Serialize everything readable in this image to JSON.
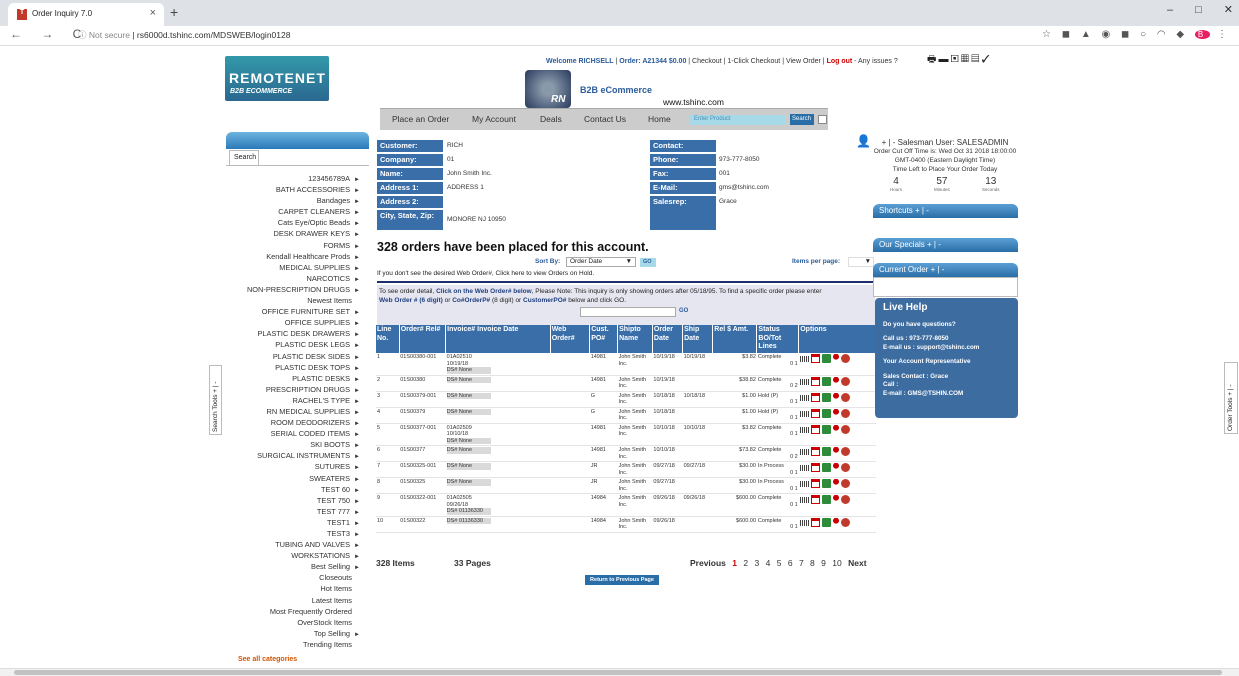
{
  "browser": {
    "tab_title": "Order Inquiry 7.0",
    "tab_close": "×",
    "new_tab": "+",
    "nav": "← → C",
    "url_secure": "ⓘ Not secure",
    "url": "rs6000d.tshinc.com/MDSWEB/login0128",
    "window_controls": [
      "–",
      "□",
      "✕"
    ]
  },
  "header": {
    "logo_line1": "REMOTENET",
    "logo_line2": "B2B ECOMMERCE",
    "rn_logo": "RN",
    "b2b_title": "B2B eCommerce",
    "site": "www.tshinc.com",
    "welcome": "Welcome RICHSELL",
    "order": "Order: A21344 $0.00",
    "links": "| Checkout | 1-Click Checkout | View Order |",
    "logout": "Log out",
    "issues": "- Any issues ?"
  },
  "topnav": {
    "items": [
      "Place an Order",
      "My Account",
      "Deals",
      "Contact Us",
      "Home"
    ],
    "search_placeholder": "Enter Product",
    "search_button": "Search"
  },
  "sidebar": {
    "tab": "Search",
    "categories": [
      {
        "label": "123456789A",
        "arrow": "►"
      },
      {
        "label": "BATH ACCESSORIES",
        "arrow": "►"
      },
      {
        "label": "Bandages",
        "arrow": "►"
      },
      {
        "label": "CARPET CLEANERS",
        "arrow": "►"
      },
      {
        "label": "Cats Eye/Optic Beads",
        "arrow": "►"
      },
      {
        "label": "DESK DRAWER KEYS",
        "arrow": "►"
      },
      {
        "label": "FORMS",
        "arrow": "►"
      },
      {
        "label": "Kendall Healthcare Prods",
        "arrow": "►"
      },
      {
        "label": "MEDICAL SUPPLIES",
        "arrow": "►"
      },
      {
        "label": "NARCOTICS",
        "arrow": "►"
      },
      {
        "label": "NON-PRESCRIPTION DRUGS",
        "arrow": "►"
      },
      {
        "label": "Newest Items",
        "arrow": ""
      },
      {
        "label": "OFFICE FURNITURE SET",
        "arrow": "►"
      },
      {
        "label": "OFFICE SUPPLIES",
        "arrow": "►"
      },
      {
        "label": "PLASTIC DESK DRAWERS",
        "arrow": "►"
      },
      {
        "label": "PLASTIC DESK LEGS",
        "arrow": "►"
      },
      {
        "label": "PLASTIC DESK SIDES",
        "arrow": "►"
      },
      {
        "label": "PLASTIC DESK TOPS",
        "arrow": "►"
      },
      {
        "label": "PLASTIC DESKS",
        "arrow": "►"
      },
      {
        "label": "PRESCRIPTION DRUGS",
        "arrow": "►"
      },
      {
        "label": "RACHEL'S TYPE",
        "arrow": "►"
      },
      {
        "label": "RN MEDICAL SUPPLIES",
        "arrow": "►"
      },
      {
        "label": "ROOM DEODORIZERS",
        "arrow": "►"
      },
      {
        "label": "SERIAL CODED ITEMS",
        "arrow": "►"
      },
      {
        "label": "SKI BOOTS",
        "arrow": "►"
      },
      {
        "label": "SURGICAL INSTRUMENTS",
        "arrow": "►"
      },
      {
        "label": "SUTURES",
        "arrow": "►"
      },
      {
        "label": "SWEATERS",
        "arrow": "►"
      },
      {
        "label": "TEST 60",
        "arrow": "►"
      },
      {
        "label": "TEST 750",
        "arrow": "►"
      },
      {
        "label": "TEST 777",
        "arrow": "►"
      },
      {
        "label": "TEST1",
        "arrow": "►"
      },
      {
        "label": "TEST3",
        "arrow": "►"
      },
      {
        "label": "TUBING AND VALVES",
        "arrow": "►"
      },
      {
        "label": "WORKSTATIONS",
        "arrow": "►"
      },
      {
        "label": "Best Selling",
        "arrow": "►"
      },
      {
        "label": "Closeouts",
        "arrow": ""
      },
      {
        "label": "Hot Items",
        "arrow": ""
      },
      {
        "label": "Latest Items",
        "arrow": ""
      },
      {
        "label": "Most Frequently Ordered",
        "arrow": ""
      },
      {
        "label": "OverStock Items",
        "arrow": ""
      },
      {
        "label": "Top Selling",
        "arrow": "►"
      },
      {
        "label": "Trending Items",
        "arrow": ""
      }
    ],
    "see_all": "See all categories",
    "search_tools": "Search Tools + | -",
    "order_tools": "Order Tools + | -"
  },
  "customer": {
    "labels": {
      "customer": "Customer:",
      "company": "Company:",
      "name": "Name:",
      "address1": "Address 1:",
      "address2": "Address 2:",
      "city": "City, State, Zip:",
      "contact": "Contact:",
      "phone": "Phone:",
      "fax": "Fax:",
      "email": "E-Mail:",
      "salesrep": "Salesrep:"
    },
    "values": {
      "customer": "RICH",
      "company": "01",
      "name": "John Smith Inc.",
      "address1": "ADDRESS 1",
      "address2": "",
      "city": "MONORE NJ 10950",
      "contact": "",
      "phone": "973-777-8050",
      "fax": "001",
      "email": "gms@tshinc.com",
      "salesrep": "Grace"
    }
  },
  "orders": {
    "heading": "328 orders have been placed for this account.",
    "sort_by_label": "Sort By:",
    "sort_by_value": "Order Date",
    "go": "GO",
    "items_per_page": "Items per page:",
    "hold_note": "If you don't see the desired Web Order#, Click here to view Orders on Hold.",
    "instr_1": "To see order detail, ",
    "instr_1b": "Click on the Web Order# below",
    "instr_1c": ", Please Note: This inquiry is only showing orders after 05/18/95. To find a specific order please enter",
    "instr_2a": "Web Order # (6 digit)",
    "instr_2b": " or ",
    "instr_2c": "Co#OrderP#",
    "instr_2d": " (8 digit) or ",
    "instr_2e": "CustomerPO#",
    "instr_2f": " below and click GO.",
    "instr_go": "GO",
    "columns": [
      "Line No.",
      "Order# Rel#",
      "Invoice# Invoice Date",
      "Web Order#",
      "Cust. PO#",
      "Shipto Name",
      "Order Date",
      "Ship Date",
      "Rel $ Amt.",
      "Status BO/Tot Lines",
      "Options"
    ],
    "rows": [
      {
        "line": "1",
        "order": "01S00380-001",
        "invoice": "01A02510",
        "inv_date": "10/19/18",
        "ds": "DS# None",
        "web": "",
        "po": "14981",
        "shipto": "John Smith Inc.",
        "odate": "10/19/18",
        "sdate": "10/19/18",
        "amt": "$3.82",
        "status": "Complete",
        "lines": "0 1"
      },
      {
        "line": "2",
        "order": "01S00380",
        "invoice": "",
        "inv_date": "",
        "ds": "DS# None",
        "web": "",
        "po": "14981",
        "shipto": "John Smith Inc.",
        "odate": "10/19/18",
        "sdate": "",
        "amt": "$38.82",
        "status": "Complete",
        "lines": "0 2"
      },
      {
        "line": "3",
        "order": "01S00379-001",
        "invoice": "",
        "inv_date": "",
        "ds": "DS# None",
        "web": "",
        "po": "G",
        "shipto": "John Smith Inc.",
        "odate": "10/18/18",
        "sdate": "10/18/18",
        "amt": "$1.00",
        "status": "Hold (P)",
        "lines": "0 1"
      },
      {
        "line": "4",
        "order": "01S00379",
        "invoice": "",
        "inv_date": "",
        "ds": "DS# None",
        "web": "",
        "po": "G",
        "shipto": "John Smith Inc.",
        "odate": "10/18/18",
        "sdate": "",
        "amt": "$1.00",
        "status": "Hold (P)",
        "lines": "0 1"
      },
      {
        "line": "5",
        "order": "01S00377-001",
        "invoice": "01A02509",
        "inv_date": "10/10/18",
        "ds": "DS# None",
        "web": "",
        "po": "14981",
        "shipto": "John Smith Inc.",
        "odate": "10/10/18",
        "sdate": "10/10/18",
        "amt": "$3.82",
        "status": "Complete",
        "lines": "0 1"
      },
      {
        "line": "6",
        "order": "01S00377",
        "invoice": "",
        "inv_date": "",
        "ds": "DS# None",
        "web": "",
        "po": "14981",
        "shipto": "John Smith Inc.",
        "odate": "10/10/18",
        "sdate": "",
        "amt": "$73.82",
        "status": "Complete",
        "lines": "0 2"
      },
      {
        "line": "7",
        "order": "01S00325-001",
        "invoice": "",
        "inv_date": "",
        "ds": "DS# None",
        "web": "",
        "po": "JR",
        "shipto": "John Smith Inc.",
        "odate": "09/27/18",
        "sdate": "09/27/18",
        "amt": "$30.00",
        "status": "In Process",
        "lines": "0 1"
      },
      {
        "line": "8",
        "order": "01S00325",
        "invoice": "",
        "inv_date": "",
        "ds": "DS# None",
        "web": "",
        "po": "JR",
        "shipto": "John Smith Inc.",
        "odate": "09/27/18",
        "sdate": "",
        "amt": "$30.00",
        "status": "In Process",
        "lines": "0 1"
      },
      {
        "line": "9",
        "order": "01S00322-001",
        "invoice": "01A02505",
        "inv_date": "09/26/18",
        "ds": "DS# 01136330",
        "web": "",
        "po": "14984",
        "shipto": "John Smith Inc.",
        "odate": "09/26/18",
        "sdate": "09/26/18",
        "amt": "$600.00",
        "status": "Complete",
        "lines": "0 1"
      },
      {
        "line": "10",
        "order": "01S00322",
        "invoice": "",
        "inv_date": "",
        "ds": "DS# 01136330",
        "web": "",
        "po": "14984",
        "shipto": "John Smith Inc.",
        "odate": "09/26/18",
        "sdate": "",
        "amt": "$600.00",
        "status": "Complete",
        "lines": "0 1"
      }
    ],
    "items_count": "328 Items",
    "pages_count": "33 Pages",
    "previous": "Previous",
    "pages": [
      "1",
      "2",
      "3",
      "4",
      "5",
      "6",
      "7",
      "8",
      "9",
      "10"
    ],
    "next": "Next",
    "return_button": "Return to Previous Page"
  },
  "right": {
    "salesman": "+ | - Salesman User: SALESADMIN",
    "cutoff": "Order Cut Off Time is: Wed Oct 31 2018 18:00:00 GMT-0400 (Eastern Daylight Time)",
    "time_left": "Time Left to Place Your Order Today",
    "hours": "4",
    "hours_label": "Hours",
    "minutes": "57",
    "minutes_label": "Minutes",
    "seconds": "13",
    "seconds_label": "Seconds",
    "shortcuts": "Shortcuts + | -",
    "specials": "Our Specials + | -",
    "current_order": "Current Order + | -",
    "live_help_title": "Live Help",
    "questions": "Do you have questions?",
    "call_us": "Call us : 973-777-8050",
    "email_us": "E-mail us : support@tshinc.com",
    "account_rep": "Your Account Representative",
    "sales_contact": "Sales Contact : Grace",
    "call": "Call :",
    "email": "E-mail : GMS@TSHIN.COM"
  }
}
